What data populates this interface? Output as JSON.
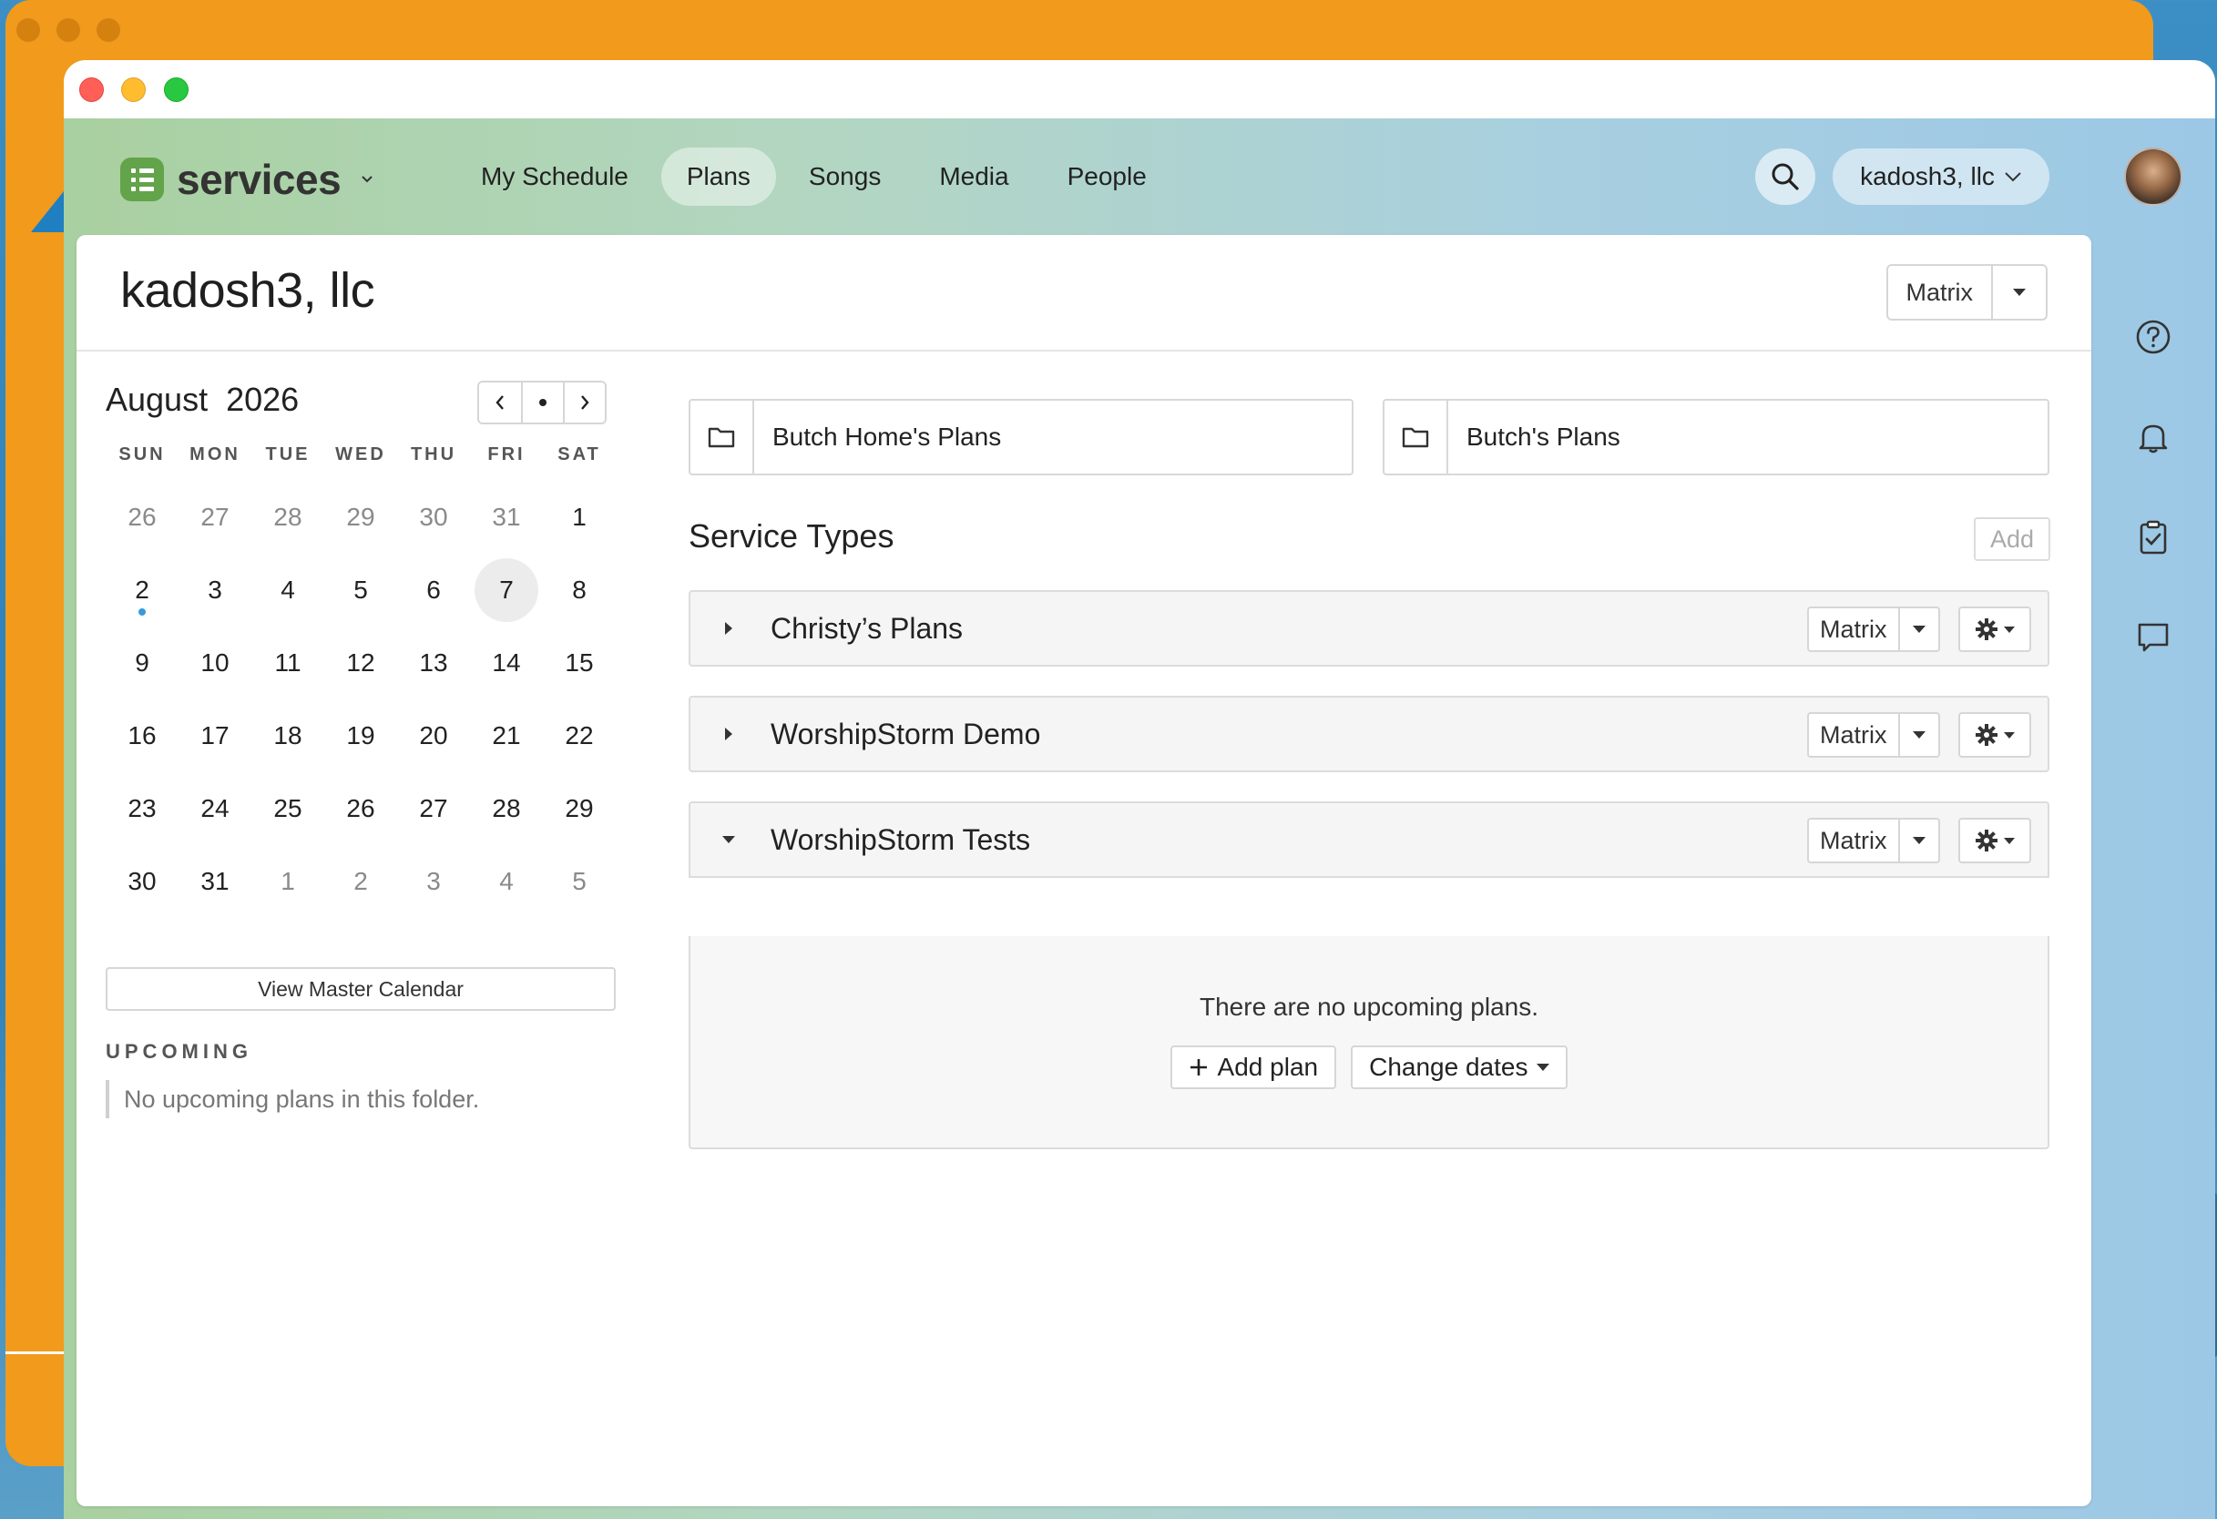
{
  "app": {
    "name": "services"
  },
  "nav": {
    "items": [
      {
        "label": "My Schedule",
        "active": false
      },
      {
        "label": "Plans",
        "active": true
      },
      {
        "label": "Songs",
        "active": false
      },
      {
        "label": "Media",
        "active": false
      },
      {
        "label": "People",
        "active": false
      }
    ]
  },
  "header": {
    "org_label": "kadosh3, llc"
  },
  "page": {
    "title": "kadosh3, llc",
    "view_label": "Matrix"
  },
  "calendar": {
    "month": "August",
    "year": "2026",
    "dow": [
      "SUN",
      "MON",
      "TUE",
      "WED",
      "THU",
      "FRI",
      "SAT"
    ],
    "weeks": [
      [
        {
          "d": "26",
          "m": true
        },
        {
          "d": "27",
          "m": true
        },
        {
          "d": "28",
          "m": true
        },
        {
          "d": "29",
          "m": true
        },
        {
          "d": "30",
          "m": true
        },
        {
          "d": "31",
          "m": true
        },
        {
          "d": "1"
        }
      ],
      [
        {
          "d": "2",
          "today": true
        },
        {
          "d": "3"
        },
        {
          "d": "4"
        },
        {
          "d": "5"
        },
        {
          "d": "6"
        },
        {
          "d": "7",
          "selected": true
        },
        {
          "d": "8"
        }
      ],
      [
        {
          "d": "9"
        },
        {
          "d": "10"
        },
        {
          "d": "11"
        },
        {
          "d": "12"
        },
        {
          "d": "13"
        },
        {
          "d": "14"
        },
        {
          "d": "15"
        }
      ],
      [
        {
          "d": "16"
        },
        {
          "d": "17"
        },
        {
          "d": "18"
        },
        {
          "d": "19"
        },
        {
          "d": "20"
        },
        {
          "d": "21"
        },
        {
          "d": "22"
        }
      ],
      [
        {
          "d": "23"
        },
        {
          "d": "24"
        },
        {
          "d": "25"
        },
        {
          "d": "26"
        },
        {
          "d": "27"
        },
        {
          "d": "28"
        },
        {
          "d": "29"
        }
      ],
      [
        {
          "d": "30"
        },
        {
          "d": "31"
        },
        {
          "d": "1",
          "m": true
        },
        {
          "d": "2",
          "m": true
        },
        {
          "d": "3",
          "m": true
        },
        {
          "d": "4",
          "m": true
        },
        {
          "d": "5",
          "m": true
        }
      ]
    ],
    "view_master_label": "View Master Calendar"
  },
  "upcoming": {
    "heading": "UPCOMING",
    "empty": "No upcoming plans in this folder."
  },
  "folders": [
    {
      "name": "Butch Home's Plans"
    },
    {
      "name": "Butch's Plans"
    }
  ],
  "service_types": {
    "heading": "Service Types",
    "add_label": "Add",
    "items": [
      {
        "name": "Christy’s Plans",
        "view": "Matrix",
        "expanded": false
      },
      {
        "name": "WorshipStorm Demo",
        "view": "Matrix",
        "expanded": false
      },
      {
        "name": "WorshipStorm Tests",
        "view": "Matrix",
        "expanded": true
      }
    ],
    "empty_message": "There are no upcoming plans.",
    "add_plan_label": "Add plan",
    "change_dates_label": "Change dates"
  },
  "colors": {
    "brand_green": "#63a34a",
    "today_dot": "#3a9ad9"
  },
  "icons": [
    "search-icon",
    "chevron-down-icon",
    "help-icon",
    "bell-icon",
    "clipboard-check-icon",
    "chat-icon",
    "folder-icon",
    "gear-icon",
    "plus-icon",
    "caret-right-icon",
    "caret-down-icon"
  ]
}
